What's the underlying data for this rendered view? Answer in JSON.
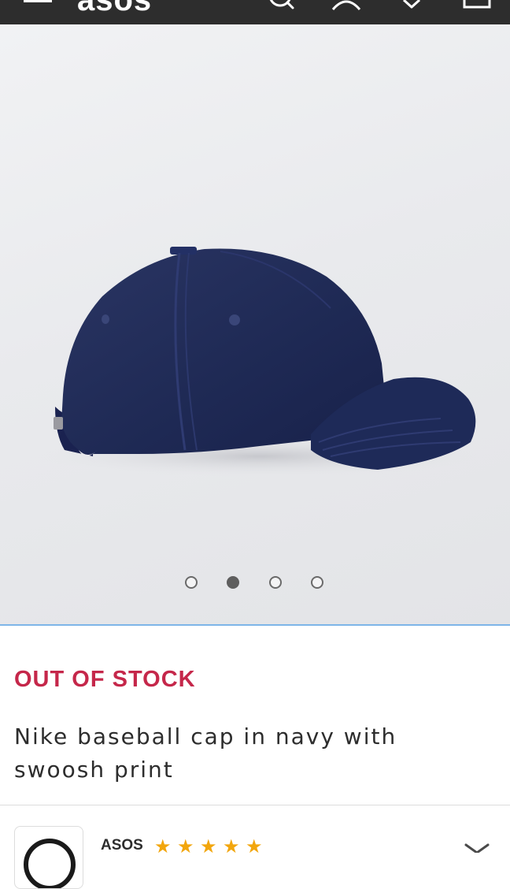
{
  "header": {
    "logo_text": "asos",
    "background": "#2d2d2d",
    "icons": [
      "menu-icon",
      "search-icon",
      "account-icon",
      "wishlist-icon",
      "bag-icon"
    ]
  },
  "gallery": {
    "image_alt": "Navy Nike baseball cap, side view",
    "total_images": 4,
    "active_index": 1
  },
  "product": {
    "stock_status": "OUT OF STOCK",
    "stock_color": "#c5274a",
    "title": "Nike baseball cap in navy with swoosh print"
  },
  "seller": {
    "name": "ASOS",
    "rating": 5,
    "star_color": "#f2a60d"
  }
}
